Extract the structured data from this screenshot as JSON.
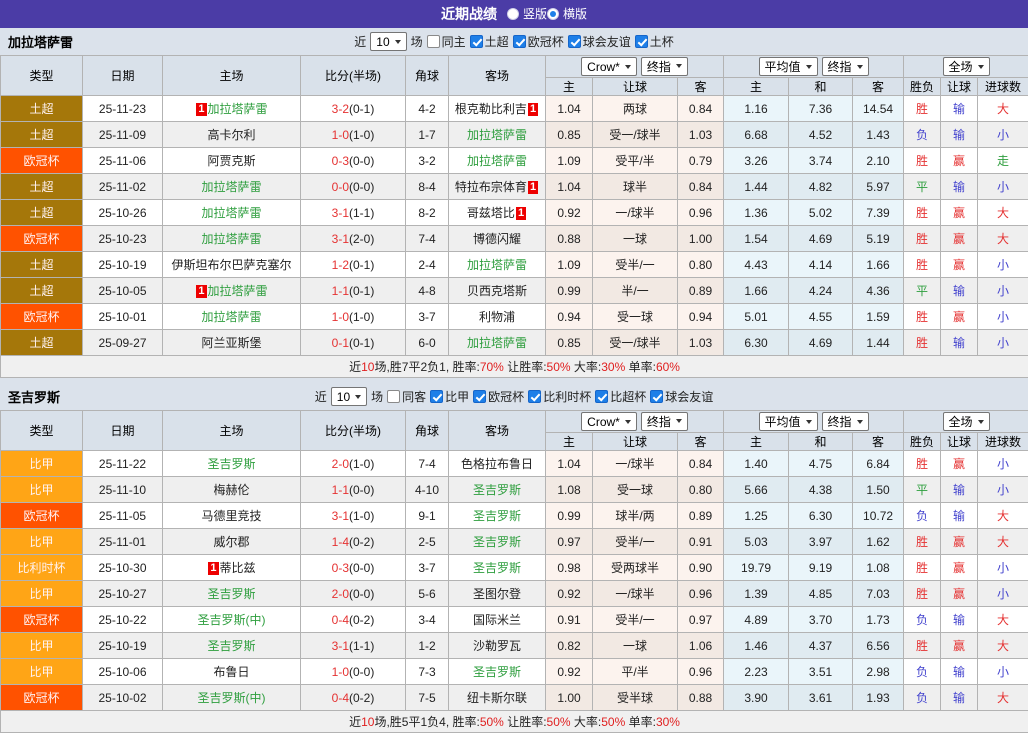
{
  "title_bar": {
    "title": "近期战绩",
    "radios": [
      {
        "key": "vertical",
        "label": "竖版",
        "selected": false
      },
      {
        "key": "horizontal",
        "label": "横版",
        "selected": true
      }
    ]
  },
  "colors": {
    "titlebar_bg": "#4B3CA6",
    "page_bg": "#DBE2EB",
    "score_red": "#E53232",
    "team_green": "#2E9E3E",
    "rank_badge_red": "#ED0000",
    "checkbox_blue": "#1E7FE8",
    "league": {
      "土超": "#A5770A",
      "欧冠杯": "#FF5200",
      "比甲": "#FFA516",
      "比利时杯": "#FFA516"
    },
    "result": {
      "r": "#E53232",
      "g": "#2E9E3E",
      "b": "#4343CE"
    }
  },
  "table_headers": {
    "base": [
      "类型",
      "日期",
      "主场",
      "比分(半场)",
      "角球",
      "客场"
    ],
    "sub": [
      "主",
      "让球",
      "客",
      "主",
      "和",
      "客",
      "胜负",
      "让球",
      "进球数"
    ],
    "selects": {
      "odds_source": "Crow*",
      "odds_time": "终指",
      "avg_source": "平均值",
      "avg_time": "终指",
      "scope": "全场"
    }
  },
  "sections": [
    {
      "team": "加拉塔萨雷",
      "filters": {
        "near": "近",
        "count": "10",
        "games": "场",
        "same": {
          "label": "同主",
          "checked": false
        },
        "leagues": [
          {
            "label": "土超",
            "checked": true
          },
          {
            "label": "欧冠杯",
            "checked": true
          },
          {
            "label": "球会友谊",
            "checked": true
          },
          {
            "label": "土杯",
            "checked": true
          }
        ]
      },
      "rows": [
        {
          "lg": "土超",
          "date": "25-11-23",
          "home": {
            "n": "加拉塔萨雷",
            "hl": true,
            "b": "pre"
          },
          "ft": "3-2",
          "ht": "(0-1)",
          "cn": "4-2",
          "away": {
            "n": "根克勒比利吉",
            "hl": false,
            "b": "post"
          },
          "odds": [
            "1.04",
            "两球",
            "0.84"
          ],
          "avg": [
            "1.16",
            "7.36",
            "14.54"
          ],
          "res": [
            [
              "胜",
              "r"
            ],
            [
              "输",
              "b"
            ],
            [
              "大",
              "r"
            ]
          ]
        },
        {
          "lg": "土超",
          "date": "25-11-09",
          "home": {
            "n": "高卡尔利",
            "hl": false,
            "b": null
          },
          "ft": "1-0",
          "ht": "(1-0)",
          "cn": "1-7",
          "away": {
            "n": "加拉塔萨雷",
            "hl": true,
            "b": null
          },
          "odds": [
            "0.85",
            "受一/球半",
            "1.03"
          ],
          "avg": [
            "6.68",
            "4.52",
            "1.43"
          ],
          "res": [
            [
              "负",
              "b"
            ],
            [
              "输",
              "b"
            ],
            [
              "小",
              "b"
            ]
          ]
        },
        {
          "lg": "欧冠杯",
          "date": "25-11-06",
          "home": {
            "n": "阿贾克斯",
            "hl": false,
            "b": null
          },
          "ft": "0-3",
          "ht": "(0-0)",
          "cn": "3-2",
          "away": {
            "n": "加拉塔萨雷",
            "hl": true,
            "b": null
          },
          "odds": [
            "1.09",
            "受平/半",
            "0.79"
          ],
          "avg": [
            "3.26",
            "3.74",
            "2.10"
          ],
          "res": [
            [
              "胜",
              "r"
            ],
            [
              "赢",
              "r"
            ],
            [
              "走",
              "g"
            ]
          ]
        },
        {
          "lg": "土超",
          "date": "25-11-02",
          "home": {
            "n": "加拉塔萨雷",
            "hl": true,
            "b": null
          },
          "ft": "0-0",
          "ht": "(0-0)",
          "cn": "8-4",
          "away": {
            "n": "特拉布宗体育",
            "hl": false,
            "b": "post"
          },
          "odds": [
            "1.04",
            "球半",
            "0.84"
          ],
          "avg": [
            "1.44",
            "4.82",
            "5.97"
          ],
          "res": [
            [
              "平",
              "g"
            ],
            [
              "输",
              "b"
            ],
            [
              "小",
              "b"
            ]
          ]
        },
        {
          "lg": "土超",
          "date": "25-10-26",
          "home": {
            "n": "加拉塔萨雷",
            "hl": true,
            "b": null
          },
          "ft": "3-1",
          "ht": "(1-1)",
          "cn": "8-2",
          "away": {
            "n": "哥兹塔比",
            "hl": false,
            "b": "post"
          },
          "odds": [
            "0.92",
            "一/球半",
            "0.96"
          ],
          "avg": [
            "1.36",
            "5.02",
            "7.39"
          ],
          "res": [
            [
              "胜",
              "r"
            ],
            [
              "赢",
              "r"
            ],
            [
              "大",
              "r"
            ]
          ]
        },
        {
          "lg": "欧冠杯",
          "date": "25-10-23",
          "home": {
            "n": "加拉塔萨雷",
            "hl": true,
            "b": null
          },
          "ft": "3-1",
          "ht": "(2-0)",
          "cn": "7-4",
          "away": {
            "n": "博德闪耀",
            "hl": false,
            "b": null
          },
          "odds": [
            "0.88",
            "一球",
            "1.00"
          ],
          "avg": [
            "1.54",
            "4.69",
            "5.19"
          ],
          "res": [
            [
              "胜",
              "r"
            ],
            [
              "赢",
              "r"
            ],
            [
              "大",
              "r"
            ]
          ]
        },
        {
          "lg": "土超",
          "date": "25-10-19",
          "home": {
            "n": "伊斯坦布尔巴萨克塞尔",
            "hl": false,
            "b": null
          },
          "ft": "1-2",
          "ht": "(0-1)",
          "cn": "2-4",
          "away": {
            "n": "加拉塔萨雷",
            "hl": true,
            "b": null
          },
          "odds": [
            "1.09",
            "受半/一",
            "0.80"
          ],
          "avg": [
            "4.43",
            "4.14",
            "1.66"
          ],
          "res": [
            [
              "胜",
              "r"
            ],
            [
              "赢",
              "r"
            ],
            [
              "小",
              "b"
            ]
          ]
        },
        {
          "lg": "土超",
          "date": "25-10-05",
          "home": {
            "n": "加拉塔萨雷",
            "hl": true,
            "b": "pre"
          },
          "ft": "1-1",
          "ht": "(0-1)",
          "cn": "4-8",
          "away": {
            "n": "贝西克塔斯",
            "hl": false,
            "b": null
          },
          "odds": [
            "0.99",
            "半/一",
            "0.89"
          ],
          "avg": [
            "1.66",
            "4.24",
            "4.36"
          ],
          "res": [
            [
              "平",
              "g"
            ],
            [
              "输",
              "b"
            ],
            [
              "小",
              "b"
            ]
          ]
        },
        {
          "lg": "欧冠杯",
          "date": "25-10-01",
          "home": {
            "n": "加拉塔萨雷",
            "hl": true,
            "b": null
          },
          "ft": "1-0",
          "ht": "(1-0)",
          "cn": "3-7",
          "away": {
            "n": "利物浦",
            "hl": false,
            "b": null
          },
          "odds": [
            "0.94",
            "受一球",
            "0.94"
          ],
          "avg": [
            "5.01",
            "4.55",
            "1.59"
          ],
          "res": [
            [
              "胜",
              "r"
            ],
            [
              "赢",
              "r"
            ],
            [
              "小",
              "b"
            ]
          ]
        },
        {
          "lg": "土超",
          "date": "25-09-27",
          "home": {
            "n": "阿兰亚斯堡",
            "hl": false,
            "b": null
          },
          "ft": "0-1",
          "ht": "(0-1)",
          "cn": "6-0",
          "away": {
            "n": "加拉塔萨雷",
            "hl": true,
            "b": null
          },
          "odds": [
            "0.85",
            "受一/球半",
            "1.03"
          ],
          "avg": [
            "6.30",
            "4.69",
            "1.44"
          ],
          "res": [
            [
              "胜",
              "r"
            ],
            [
              "输",
              "b"
            ],
            [
              "小",
              "b"
            ]
          ]
        }
      ],
      "summary": [
        [
          "近",
          0
        ],
        [
          "10",
          1
        ],
        [
          "场,胜7平2负1, 胜率:",
          0
        ],
        [
          "70%",
          1
        ],
        [
          " 让胜率:",
          0
        ],
        [
          "50%",
          1
        ],
        [
          " 大率:",
          0
        ],
        [
          "30%",
          1
        ],
        [
          " 单率:",
          0
        ],
        [
          "60%",
          1
        ]
      ]
    },
    {
      "team": "圣吉罗斯",
      "filters": {
        "near": "近",
        "count": "10",
        "games": "场",
        "same": {
          "label": "同客",
          "checked": false
        },
        "leagues": [
          {
            "label": "比甲",
            "checked": true
          },
          {
            "label": "欧冠杯",
            "checked": true
          },
          {
            "label": "比利时杯",
            "checked": true
          },
          {
            "label": "比超杯",
            "checked": true
          },
          {
            "label": "球会友谊",
            "checked": true
          }
        ]
      },
      "rows": [
        {
          "lg": "比甲",
          "date": "25-11-22",
          "home": {
            "n": "圣吉罗斯",
            "hl": true,
            "b": null
          },
          "ft": "2-0",
          "ht": "(1-0)",
          "cn": "7-4",
          "away": {
            "n": "色格拉布鲁日",
            "hl": false,
            "b": null
          },
          "odds": [
            "1.04",
            "一/球半",
            "0.84"
          ],
          "avg": [
            "1.40",
            "4.75",
            "6.84"
          ],
          "res": [
            [
              "胜",
              "r"
            ],
            [
              "赢",
              "r"
            ],
            [
              "小",
              "b"
            ]
          ]
        },
        {
          "lg": "比甲",
          "date": "25-11-10",
          "home": {
            "n": "梅赫伦",
            "hl": false,
            "b": null
          },
          "ft": "1-1",
          "ht": "(0-0)",
          "cn": "4-10",
          "away": {
            "n": "圣吉罗斯",
            "hl": true,
            "b": null
          },
          "odds": [
            "1.08",
            "受一球",
            "0.80"
          ],
          "avg": [
            "5.66",
            "4.38",
            "1.50"
          ],
          "res": [
            [
              "平",
              "g"
            ],
            [
              "输",
              "b"
            ],
            [
              "小",
              "b"
            ]
          ]
        },
        {
          "lg": "欧冠杯",
          "date": "25-11-05",
          "home": {
            "n": "马德里竞技",
            "hl": false,
            "b": null
          },
          "ft": "3-1",
          "ht": "(1-0)",
          "cn": "9-1",
          "away": {
            "n": "圣吉罗斯",
            "hl": true,
            "b": null
          },
          "odds": [
            "0.99",
            "球半/两",
            "0.89"
          ],
          "avg": [
            "1.25",
            "6.30",
            "10.72"
          ],
          "res": [
            [
              "负",
              "b"
            ],
            [
              "输",
              "b"
            ],
            [
              "大",
              "r"
            ]
          ]
        },
        {
          "lg": "比甲",
          "date": "25-11-01",
          "home": {
            "n": "威尔郡",
            "hl": false,
            "b": null
          },
          "ft": "1-4",
          "ht": "(0-2)",
          "cn": "2-5",
          "away": {
            "n": "圣吉罗斯",
            "hl": true,
            "b": null
          },
          "odds": [
            "0.97",
            "受半/一",
            "0.91"
          ],
          "avg": [
            "5.03",
            "3.97",
            "1.62"
          ],
          "res": [
            [
              "胜",
              "r"
            ],
            [
              "赢",
              "r"
            ],
            [
              "大",
              "r"
            ]
          ]
        },
        {
          "lg": "比利时杯",
          "date": "25-10-30",
          "home": {
            "n": "蒂比兹",
            "hl": false,
            "b": "pre"
          },
          "ft": "0-3",
          "ht": "(0-0)",
          "cn": "3-7",
          "away": {
            "n": "圣吉罗斯",
            "hl": true,
            "b": null
          },
          "odds": [
            "0.98",
            "受两球半",
            "0.90"
          ],
          "avg": [
            "19.79",
            "9.19",
            "1.08"
          ],
          "res": [
            [
              "胜",
              "r"
            ],
            [
              "赢",
              "r"
            ],
            [
              "小",
              "b"
            ]
          ]
        },
        {
          "lg": "比甲",
          "date": "25-10-27",
          "home": {
            "n": "圣吉罗斯",
            "hl": true,
            "b": null
          },
          "ft": "2-0",
          "ht": "(0-0)",
          "cn": "5-6",
          "away": {
            "n": "圣图尔登",
            "hl": false,
            "b": null
          },
          "odds": [
            "0.92",
            "一/球半",
            "0.96"
          ],
          "avg": [
            "1.39",
            "4.85",
            "7.03"
          ],
          "res": [
            [
              "胜",
              "r"
            ],
            [
              "赢",
              "r"
            ],
            [
              "小",
              "b"
            ]
          ]
        },
        {
          "lg": "欧冠杯",
          "date": "25-10-22",
          "home": {
            "n": "圣吉罗斯(中)",
            "hl": true,
            "b": null
          },
          "ft": "0-4",
          "ht": "(0-2)",
          "cn": "3-4",
          "away": {
            "n": "国际米兰",
            "hl": false,
            "b": null
          },
          "odds": [
            "0.91",
            "受半/一",
            "0.97"
          ],
          "avg": [
            "4.89",
            "3.70",
            "1.73"
          ],
          "res": [
            [
              "负",
              "b"
            ],
            [
              "输",
              "b"
            ],
            [
              "大",
              "r"
            ]
          ]
        },
        {
          "lg": "比甲",
          "date": "25-10-19",
          "home": {
            "n": "圣吉罗斯",
            "hl": true,
            "b": null
          },
          "ft": "3-1",
          "ht": "(1-1)",
          "cn": "1-2",
          "away": {
            "n": "沙勒罗瓦",
            "hl": false,
            "b": null
          },
          "odds": [
            "0.82",
            "一球",
            "1.06"
          ],
          "avg": [
            "1.46",
            "4.37",
            "6.56"
          ],
          "res": [
            [
              "胜",
              "r"
            ],
            [
              "赢",
              "r"
            ],
            [
              "大",
              "r"
            ]
          ]
        },
        {
          "lg": "比甲",
          "date": "25-10-06",
          "home": {
            "n": "布鲁日",
            "hl": false,
            "b": null
          },
          "ft": "1-0",
          "ht": "(0-0)",
          "cn": "7-3",
          "away": {
            "n": "圣吉罗斯",
            "hl": true,
            "b": null
          },
          "odds": [
            "0.92",
            "平/半",
            "0.96"
          ],
          "avg": [
            "2.23",
            "3.51",
            "2.98"
          ],
          "res": [
            [
              "负",
              "b"
            ],
            [
              "输",
              "b"
            ],
            [
              "小",
              "b"
            ]
          ]
        },
        {
          "lg": "欧冠杯",
          "date": "25-10-02",
          "home": {
            "n": "圣吉罗斯(中)",
            "hl": true,
            "b": null
          },
          "ft": "0-4",
          "ht": "(0-2)",
          "cn": "7-5",
          "away": {
            "n": "纽卡斯尔联",
            "hl": false,
            "b": null
          },
          "odds": [
            "1.00",
            "受半球",
            "0.88"
          ],
          "avg": [
            "3.90",
            "3.61",
            "1.93"
          ],
          "res": [
            [
              "负",
              "b"
            ],
            [
              "输",
              "b"
            ],
            [
              "大",
              "r"
            ]
          ]
        }
      ],
      "summary": [
        [
          "近",
          0
        ],
        [
          "10",
          1
        ],
        [
          "场,胜5平1负4, 胜率:",
          0
        ],
        [
          "50%",
          1
        ],
        [
          " 让胜率:",
          0
        ],
        [
          "50%",
          1
        ],
        [
          " 大率:",
          0
        ],
        [
          "50%",
          1
        ],
        [
          " 单率:",
          0
        ],
        [
          "30%",
          1
        ]
      ]
    }
  ]
}
